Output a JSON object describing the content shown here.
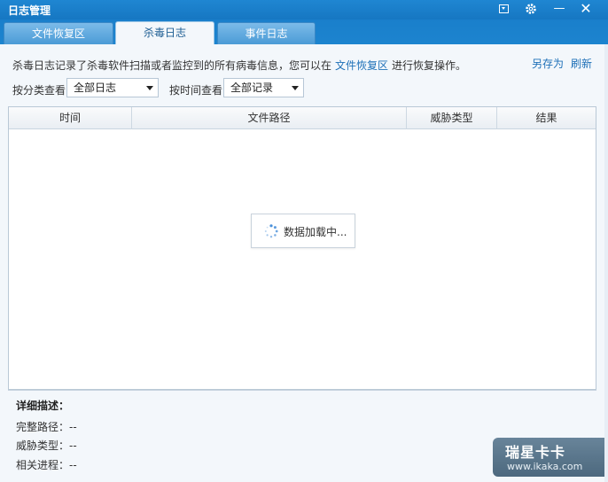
{
  "window": {
    "title": "日志管理",
    "controls": {
      "menu_icon": "dropdown-menu-icon",
      "gear_icon": "gear-icon",
      "min_glyph": "—",
      "close_glyph": "✕"
    }
  },
  "tabs": [
    {
      "label": "文件恢复区",
      "active": false
    },
    {
      "label": "杀毒日志",
      "active": true
    },
    {
      "label": "事件日志",
      "active": false
    }
  ],
  "info": {
    "prefix": "杀毒日志记录了杀毒软件扫描或者监控到的所有病毒信息，您可以在",
    "link": "文件恢复区",
    "suffix": "进行恢复操作。"
  },
  "actions": {
    "save_as": "另存为",
    "refresh": "刷新"
  },
  "filters": {
    "category": {
      "label": "按分类查看",
      "selected": "全部日志"
    },
    "time": {
      "label": "按时间查看",
      "selected": "全部记录"
    }
  },
  "table": {
    "columns": [
      "时间",
      "文件路径",
      "威胁类型",
      "结果"
    ],
    "rows": [],
    "loading_text": "数据加载中..."
  },
  "detail": {
    "title": "详细描述：",
    "rows": [
      {
        "label": "完整路径：",
        "value": "--"
      },
      {
        "label": "威胁类型：",
        "value": "--"
      },
      {
        "label": "相关进程：",
        "value": "--"
      }
    ]
  },
  "watermark": {
    "line1": "瑞星卡卡",
    "line2": "www.ikaka.com"
  },
  "colors": {
    "titlebar": "#1677c2",
    "accent_link": "#1e70b8",
    "panel_bg": "#f3f7fb"
  }
}
